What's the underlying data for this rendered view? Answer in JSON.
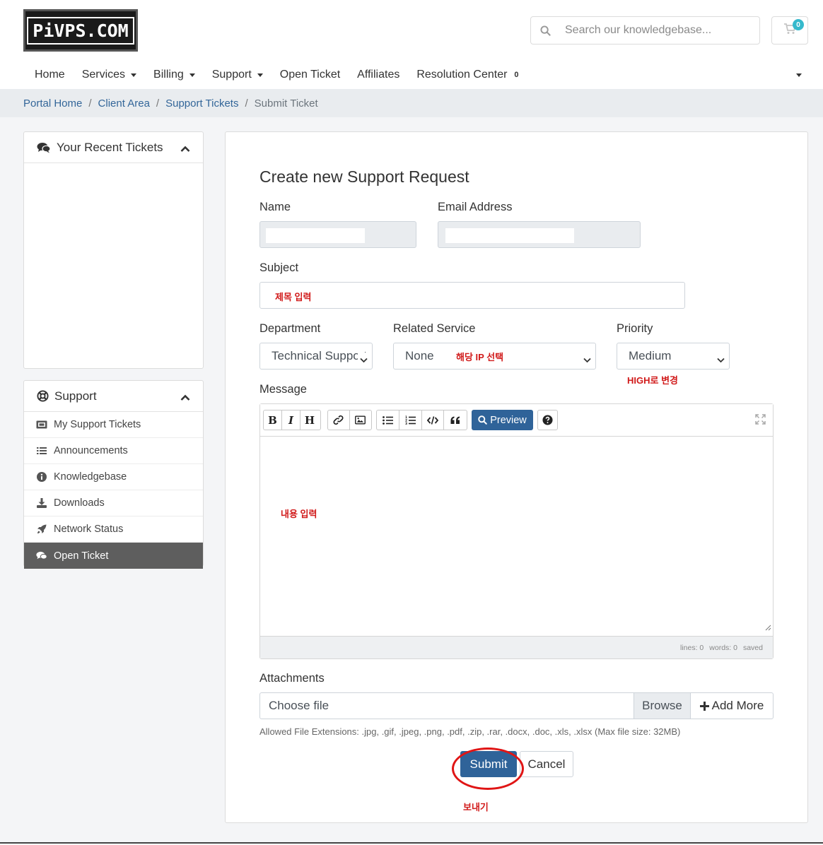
{
  "header": {
    "logo_text": "PiVPS.COM",
    "search_placeholder": "Search our knowledgebase...",
    "cart_count": "0"
  },
  "nav": {
    "items": [
      {
        "label": "Home",
        "dropdown": false
      },
      {
        "label": "Services",
        "dropdown": true
      },
      {
        "label": "Billing",
        "dropdown": true
      },
      {
        "label": "Support",
        "dropdown": true
      },
      {
        "label": "Open Ticket",
        "dropdown": false
      },
      {
        "label": "Affiliates",
        "dropdown": false
      },
      {
        "label": "Resolution Center",
        "dropdown": false
      }
    ],
    "resolution_badge": "0"
  },
  "breadcrumb": {
    "items": [
      "Portal Home",
      "Client Area",
      "Support Tickets"
    ],
    "current": "Submit Ticket"
  },
  "sidebar": {
    "recent_tickets_title": "Your Recent Tickets",
    "support_title": "Support",
    "support_items": [
      {
        "label": "My Support Tickets",
        "icon": "ticket-icon"
      },
      {
        "label": "Announcements",
        "icon": "list-icon"
      },
      {
        "label": "Knowledgebase",
        "icon": "info-icon"
      },
      {
        "label": "Downloads",
        "icon": "download-icon"
      },
      {
        "label": "Network Status",
        "icon": "rocket-icon"
      },
      {
        "label": "Open Ticket",
        "icon": "comments-icon",
        "active": true
      }
    ]
  },
  "form": {
    "title": "Create new Support Request",
    "name_label": "Name",
    "email_label": "Email Address",
    "subject_label": "Subject",
    "department_label": "Department",
    "department_value": "Technical Support",
    "related_service_label": "Related Service",
    "related_service_value": "None",
    "priority_label": "Priority",
    "priority_value": "Medium",
    "message_label": "Message",
    "toolbar": {
      "bold": "B",
      "italic": "I",
      "heading": "H",
      "preview": "Preview"
    },
    "status": {
      "lines": "lines: 0",
      "words": "words: 0",
      "saved": "saved"
    },
    "attachments_label": "Attachments",
    "choose_file": "Choose file",
    "browse": "Browse",
    "add_more": "Add More",
    "allowed_ext": "Allowed File Extensions: .jpg, .gif, .jpeg, .png, .pdf, .zip, .rar, .docx, .doc, .xls, .xlsx (Max file size: 32MB)",
    "submit": "Submit",
    "cancel": "Cancel"
  },
  "annotations": {
    "subject": "제목 입력",
    "service": "해당 IP 선택",
    "priority": "HIGH로 변경",
    "message": "내용 입력",
    "submit": "보내기",
    "color": "#d11a1a"
  },
  "colors": {
    "primary": "#2f6399",
    "link": "#336699",
    "badge": "#36b9cc",
    "active_sidebar": "#5e5e5e"
  }
}
